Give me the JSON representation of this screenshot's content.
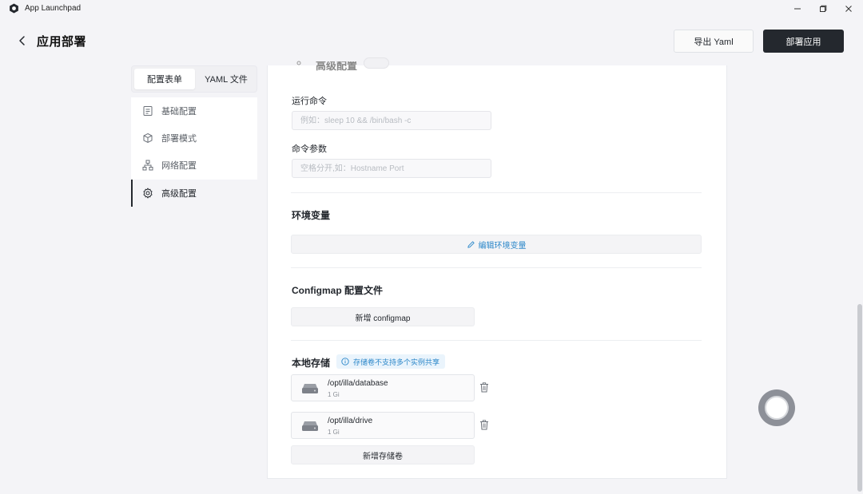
{
  "window": {
    "title": "App Launchpad",
    "minimize_glyph": "—",
    "maximize_glyph": "❐",
    "close_glyph": "✕"
  },
  "header": {
    "title": "应用部署",
    "export_label": "导出 Yaml",
    "deploy_label": "部署应用"
  },
  "tabs": [
    {
      "label": "配置表单",
      "active": true
    },
    {
      "label": "YAML 文件",
      "active": false
    }
  ],
  "nav": [
    {
      "label": "基础配置",
      "icon": "document-icon"
    },
    {
      "label": "部署模式",
      "icon": "cube-icon"
    },
    {
      "label": "网络配置",
      "icon": "network-icon"
    },
    {
      "label": "高级配置",
      "icon": "gear-icon",
      "active": true
    }
  ],
  "advanced": {
    "ghost_title": "高级配置",
    "run_command_label": "运行命令",
    "run_command_placeholder": "例如：sleep 10 && /bin/bash -c",
    "args_label": "命令参数",
    "args_placeholder": "空格分开,如：Hostname Port"
  },
  "env": {
    "title": "环境变量",
    "edit_label": "编辑环境变量"
  },
  "configmap": {
    "title": "Configmap 配置文件",
    "add_label": "新增 configmap"
  },
  "storage": {
    "title": "本地存储",
    "tip": "存储卷不支持多个实例共享",
    "volumes": [
      {
        "path": "/opt/illa/database",
        "size": "1 Gi"
      },
      {
        "path": "/opt/illa/drive",
        "size": "1 Gi"
      }
    ],
    "add_label": "新增存储卷"
  },
  "colors": {
    "accent": "#2b87c9",
    "primary_button": "#24282e",
    "background": "#f4f4f7"
  }
}
